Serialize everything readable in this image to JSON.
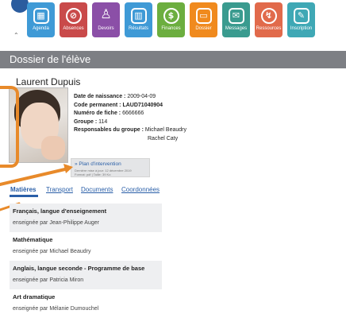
{
  "nav": {
    "items": [
      {
        "label": "Agenda",
        "icon": "calendar-icon",
        "color": "#3f9ad6"
      },
      {
        "label": "Absences",
        "icon": "absence-icon",
        "color": "#c94a4a"
      },
      {
        "label": "Devoirs",
        "icon": "person-icon",
        "color": "#8b4fa7"
      },
      {
        "label": "Résultats",
        "icon": "bar-chart-icon",
        "color": "#3f9ad6"
      },
      {
        "label": "Finances",
        "icon": "dollar-icon",
        "color": "#6cae3f"
      },
      {
        "label": "Dossier",
        "icon": "folder-icon",
        "color": "#f08a1e"
      },
      {
        "label": "Messages",
        "icon": "messages-icon",
        "color": "#3a9b8f"
      },
      {
        "label": "Ressources",
        "icon": "resources-icon",
        "color": "#e16a4b"
      },
      {
        "label": "Inscription",
        "icon": "form-icon",
        "color": "#3fa8b5"
      }
    ]
  },
  "page": {
    "title": "Dossier de l'élève"
  },
  "student": {
    "name": "Laurent Dupuis",
    "birth_label": "Date de naissance :",
    "birth_value": "2009-04-09",
    "code_label": "Code permanent :",
    "code_value": "LAUD71040904",
    "file_label": "Numéro de fiche :",
    "file_value": "6666666",
    "group_label": "Groupe :",
    "group_value": "114",
    "resp_label": "Responsables du groupe :",
    "resp_1": "Michael Beaudry",
    "resp_2": "Rachel Caty"
  },
  "plan": {
    "link": "» Plan d'intervention",
    "updated": "Dernière mise à jour: 12 décembre 2019",
    "format": "Format: pdf | Taille: 39 Ko"
  },
  "tabs": [
    "Matières",
    "Transport",
    "Documents",
    "Coordonnées"
  ],
  "courses": [
    {
      "name": "Français, langue d'enseignement",
      "teacher": "enseignée par Jean-Philippe Auger"
    },
    {
      "name": "Mathématique",
      "teacher": "enseignée par Michael Beaudry"
    },
    {
      "name": "Anglais, langue seconde - Programme de base",
      "teacher": "enseignée par Patricia Miron"
    },
    {
      "name": "Art dramatique",
      "teacher": "enseignée par Mélanie Dumouchel"
    }
  ]
}
